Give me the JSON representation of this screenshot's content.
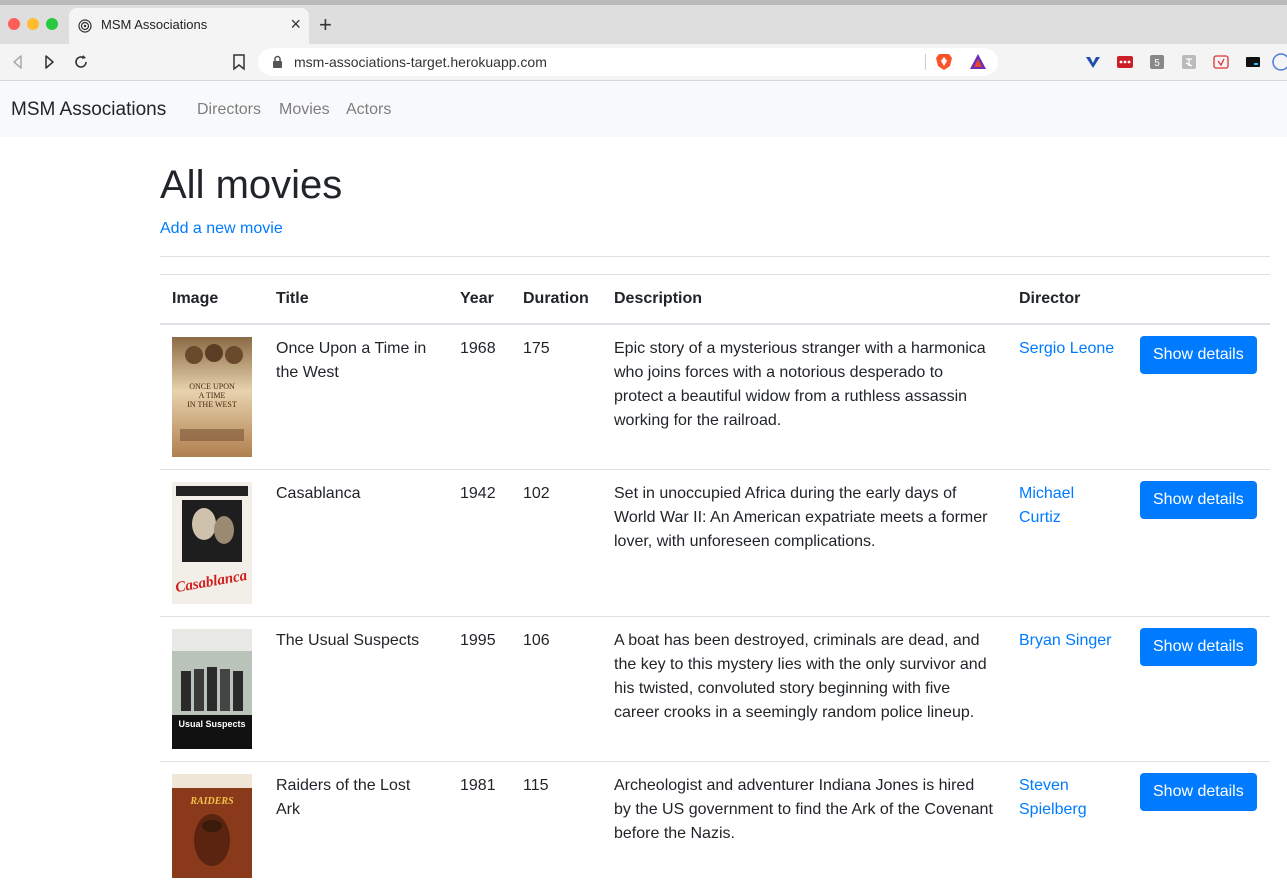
{
  "browser": {
    "tab_title": "MSM Associations",
    "new_tab_label": "+",
    "url": "msm-associations-target.herokuapp.com"
  },
  "navbar": {
    "brand": "MSM Associations",
    "links": [
      "Directors",
      "Movies",
      "Actors"
    ]
  },
  "page": {
    "title": "All movies",
    "add_link": "Add a new movie"
  },
  "table": {
    "headers": [
      "Image",
      "Title",
      "Year",
      "Duration",
      "Description",
      "Director",
      ""
    ],
    "rows": [
      {
        "title": "Once Upon a Time in the West",
        "year": "1968",
        "duration": "175",
        "description": "Epic story of a mysterious stranger with a harmonica who joins forces with a notorious desperado to protect a beautiful widow from a ruthless assassin working for the railroad.",
        "director": "Sergio Leone",
        "button": "Show details",
        "poster_text": "ONCE UPON A TIME IN THE WEST"
      },
      {
        "title": "Casablanca",
        "year": "1942",
        "duration": "102",
        "description": "Set in unoccupied Africa during the early days of World War II: An American expatriate meets a former lover, with unforeseen complications.",
        "director": "Michael Curtiz",
        "button": "Show details",
        "poster_text": "Casablanca"
      },
      {
        "title": "The Usual Suspects",
        "year": "1995",
        "duration": "106",
        "description": "A boat has been destroyed, criminals are dead, and the key to this mystery lies with the only survivor and his twisted, convoluted story beginning with five career crooks in a seemingly random police lineup.",
        "director": "Bryan Singer",
        "button": "Show details",
        "poster_text": "The Usual Suspects"
      },
      {
        "title": "Raiders of the Lost Ark",
        "year": "1981",
        "duration": "115",
        "description": "Archeologist and adventurer Indiana Jones is hired by the US government to find the Ark of the Covenant before the Nazis.",
        "director": "Steven Spielberg",
        "button": "Show details",
        "poster_text": "RAIDERS"
      }
    ]
  },
  "colors": {
    "link": "#007bff",
    "button": "#007bff",
    "navbar_bg": "#f8f9fa"
  }
}
